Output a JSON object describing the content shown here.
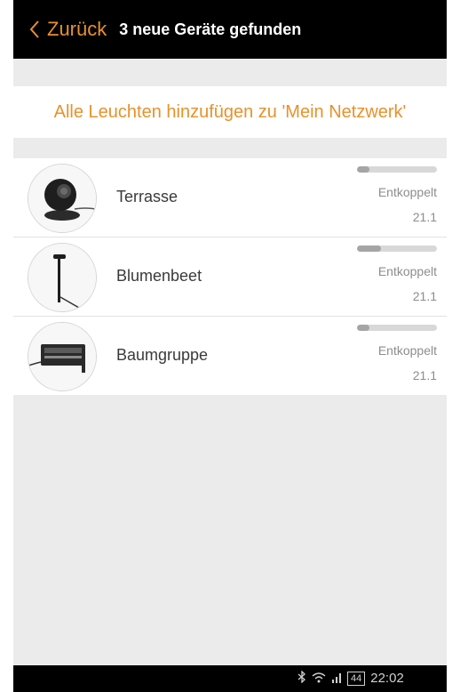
{
  "header": {
    "back_label": "Zurück",
    "title": "3 neue Geräte gefunden"
  },
  "add_all_label": "Alle Leuchten hinzufügen zu 'Mein Netzwerk'",
  "devices": [
    {
      "name": "Terrasse",
      "status": "Entkoppelt",
      "version": "21.1",
      "signal": 0.15,
      "icon": "spotlight-icon"
    },
    {
      "name": "Blumenbeet",
      "status": "Entkoppelt",
      "version": "21.1",
      "signal": 0.3,
      "icon": "stake-light-icon"
    },
    {
      "name": "Baumgruppe",
      "status": "Entkoppelt",
      "version": "21.1",
      "signal": 0.15,
      "icon": "floodlight-icon"
    }
  ],
  "statusbar": {
    "battery": "44",
    "time": "22:02"
  },
  "colors": {
    "accent": "#e8912a",
    "header_bg": "#000000",
    "background": "#ebebeb"
  }
}
